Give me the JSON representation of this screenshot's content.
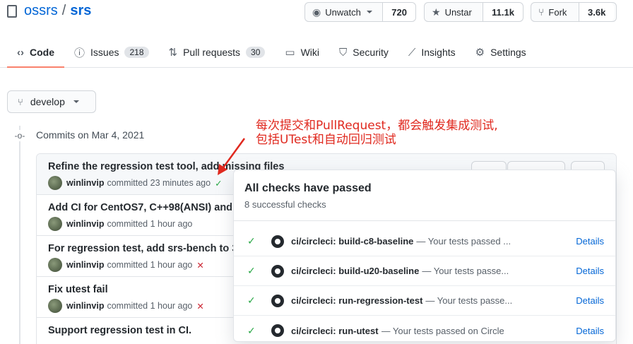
{
  "repo": {
    "owner": "ossrs",
    "separator": "/",
    "name": "srs"
  },
  "actions": [
    {
      "label": "Unwatch",
      "icon": "eye-icon",
      "glyph": "◉",
      "count": "720",
      "caret": true
    },
    {
      "label": "Unstar",
      "icon": "star-icon",
      "glyph": "★",
      "count": "11.1k",
      "caret": false
    },
    {
      "label": "Fork",
      "icon": "fork-icon",
      "glyph": "⑂",
      "count": "3.6k",
      "caret": false
    }
  ],
  "tabs": [
    {
      "label": "Code",
      "icon": "code-icon",
      "glyph": "‹›",
      "counter": ""
    },
    {
      "label": "Issues",
      "icon": "issue-icon",
      "glyph": "ⓘ",
      "counter": "218"
    },
    {
      "label": "Pull requests",
      "icon": "pull-request-icon",
      "glyph": "⇅",
      "counter": "30"
    },
    {
      "label": "Wiki",
      "icon": "book-icon",
      "glyph": "▭",
      "counter": ""
    },
    {
      "label": "Security",
      "icon": "shield-icon",
      "glyph": "⛉",
      "counter": ""
    },
    {
      "label": "Insights",
      "icon": "graph-icon",
      "glyph": "⟋",
      "counter": ""
    },
    {
      "label": "Settings",
      "icon": "gear-icon",
      "glyph": "⚙",
      "counter": ""
    }
  ],
  "branch": {
    "label": "develop",
    "icon": "branch-icon"
  },
  "commits_heading": "Commits on Mar 4, 2021",
  "commits": [
    {
      "title": "Refine the regression test tool, add missing files",
      "author": "winlinvip",
      "when": "committed 23 minutes ago",
      "status": "success"
    },
    {
      "title": "Add CI for CentOS7, C++98(ANSI) and",
      "author": "winlinvip",
      "when": "committed 1 hour ago",
      "status": "none"
    },
    {
      "title": "For regression test, add srs-bench to 3",
      "author": "winlinvip",
      "when": "committed 1 hour ago",
      "status": "failure"
    },
    {
      "title": "Fix utest fail",
      "author": "winlinvip",
      "when": "committed 1 hour ago",
      "status": "failure"
    },
    {
      "title": "Support regression test in CI.",
      "author": "",
      "when": "",
      "status": "none"
    }
  ],
  "annotation": {
    "line1": "每次提交和PullRequest，都会触发集成测试,",
    "line2": "包括UTest和自动回归测试",
    "color": "#e0291f"
  },
  "popover": {
    "title": "All checks have passed",
    "subtitle": "8 successful checks",
    "checks": [
      {
        "name": "ci/circleci: build-c8-baseline",
        "desc": "— Your tests passed ...",
        "details": "Details"
      },
      {
        "name": "ci/circleci: build-u20-baseline",
        "desc": "— Your tests passe...",
        "details": "Details"
      },
      {
        "name": "ci/circleci: run-regression-test",
        "desc": "— Your tests passe...",
        "details": "Details"
      },
      {
        "name": "ci/circleci: run-utest",
        "desc": "— Your tests passed on Circle...",
        "details": "Details"
      }
    ]
  }
}
